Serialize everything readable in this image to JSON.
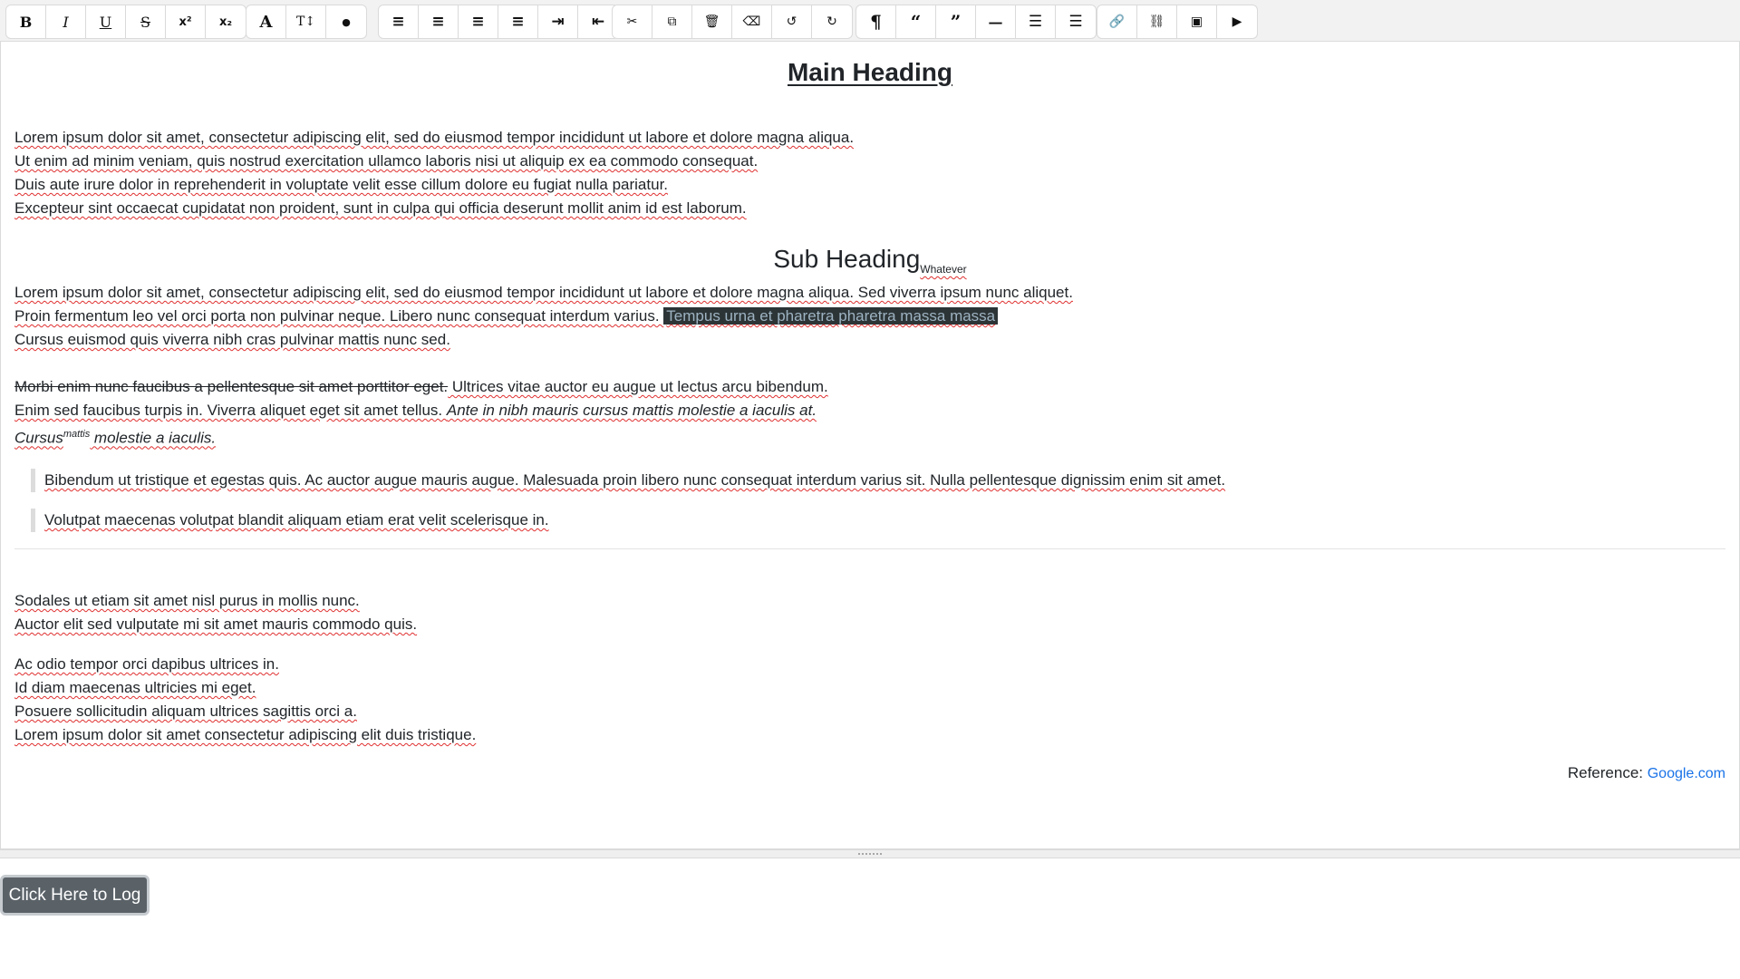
{
  "toolbar": {
    "groups": [
      [
        {
          "name": "bold-button",
          "icon": "bold-icon",
          "glyph": "B"
        },
        {
          "name": "italic-button",
          "icon": "italic-icon",
          "glyph": "I"
        },
        {
          "name": "underline-button",
          "icon": "underline-icon",
          "glyph": "U"
        },
        {
          "name": "strikethrough-button",
          "icon": "strikethrough-icon",
          "glyph": "S"
        },
        {
          "name": "superscript-button",
          "icon": "superscript-icon",
          "glyph": "x²"
        },
        {
          "name": "subscript-button",
          "icon": "subscript-icon",
          "glyph": "x₂"
        }
      ],
      [
        {
          "name": "font-button",
          "icon": "font-icon",
          "glyph": "A"
        },
        {
          "name": "font-size-button",
          "icon": "text-height-icon",
          "glyph": "T↕"
        },
        {
          "name": "color-button",
          "icon": "tint-icon",
          "glyph": "●"
        }
      ],
      [
        {
          "name": "align-left-button",
          "icon": "align-left-icon",
          "glyph": "≡"
        },
        {
          "name": "align-center-button",
          "icon": "align-center-icon",
          "glyph": "≡"
        },
        {
          "name": "align-right-button",
          "icon": "align-right-icon",
          "glyph": "≡"
        },
        {
          "name": "justify-button",
          "icon": "align-justify-icon",
          "glyph": "≡"
        },
        {
          "name": "indent-button",
          "icon": "indent-icon",
          "glyph": "⇥"
        },
        {
          "name": "outdent-button",
          "icon": "outdent-icon",
          "glyph": "⇤"
        }
      ],
      [
        {
          "name": "cut-button",
          "icon": "scissors-icon",
          "glyph": "✂"
        },
        {
          "name": "copy-button",
          "icon": "copy-icon",
          "glyph": "⧉"
        },
        {
          "name": "delete-button",
          "icon": "trash-icon",
          "glyph": "🗑"
        },
        {
          "name": "clear-format-button",
          "icon": "eraser-icon",
          "glyph": "⌫"
        },
        {
          "name": "undo-button",
          "icon": "undo-icon",
          "glyph": "↺"
        },
        {
          "name": "redo-button",
          "icon": "redo-icon",
          "glyph": "↻"
        }
      ],
      [
        {
          "name": "paragraph-button",
          "icon": "paragraph-icon",
          "glyph": "¶"
        },
        {
          "name": "quote-left-button",
          "icon": "quote-left-icon",
          "glyph": "“"
        },
        {
          "name": "quote-right-button",
          "icon": "quote-right-icon",
          "glyph": "”"
        },
        {
          "name": "horizontal-rule-button",
          "icon": "minus-icon",
          "glyph": "—"
        },
        {
          "name": "bullet-list-button",
          "icon": "list-ul-icon",
          "glyph": "☰"
        },
        {
          "name": "numbered-list-button",
          "icon": "list-ol-icon",
          "glyph": "☰"
        }
      ],
      [
        {
          "name": "link-button",
          "icon": "link-icon",
          "glyph": "🔗"
        },
        {
          "name": "unlink-button",
          "icon": "unlink-icon",
          "glyph": "⛓"
        },
        {
          "name": "image-button",
          "icon": "image-icon",
          "glyph": "▣"
        },
        {
          "name": "video-button",
          "icon": "youtube-icon",
          "glyph": "▶"
        }
      ]
    ]
  },
  "editor": {
    "main_heading": "Main Heading",
    "intro_lines": [
      "Lorem ipsum dolor sit amet, consectetur adipiscing elit, sed do eiusmod tempor incididunt ut labore et dolore magna aliqua.",
      "Ut enim ad minim veniam, quis nostrud exercitation ullamco laboris nisi ut aliquip ex ea commodo consequat.",
      "Duis aute irure dolor in reprehenderit in voluptate velit esse cillum dolore eu fugiat nulla pariatur.",
      "Excepteur sint occaecat cupidatat non proident, sunt in culpa qui officia deserunt mollit anim id est laborum."
    ],
    "sub_heading": "Sub Heading",
    "sub_heading_subscript": "Whatever",
    "section2": {
      "line1": "Lorem ipsum dolor sit amet, consectetur adipiscing elit, sed do eiusmod tempor incididunt ut labore et dolore magna aliqua. Sed viverra ipsum nunc aliquet.",
      "line2_plain": "Proin fermentum leo vel orci porta non pulvinar neque. Libero nunc consequat interdum varius. ",
      "line2_selected": "Tempus urna et pharetra pharetra massa massa",
      "line3": "Cursus euismod quis viverra nibh cras pulvinar mattis nunc sed."
    },
    "section3": {
      "strike_text": "Morbi enim nunc faucibus a pellentesque sit amet porttitor eget.",
      "line1_rest": " Ultrices vitae auctor eu augue ut lectus arcu bibendum.",
      "line2_plain": "Enim sed faucibus turpis in. Viverra aliquet eget sit amet tellus. ",
      "line2_italic": "Ante in nibh mauris cursus mattis molestie a iaculis at.",
      "line3_italic_a": "Cursus",
      "line3_sup": "mattis",
      "line3_italic_b": " molestie a iaculis."
    },
    "blockquotes": [
      "Bibendum ut tristique et egestas quis. Ac auctor augue mauris augue. Malesuada proin libero nunc consequat interdum varius sit. Nulla pellentesque dignissim enim sit amet.",
      " Volutpat maecenas volutpat blandit aliquam etiam erat velit scelerisque in."
    ],
    "after_rule_lines_a": [
      "Sodales ut etiam sit amet nisl purus in mollis nunc.",
      "Auctor elit sed vulputate mi sit amet mauris commodo quis."
    ],
    "after_rule_lines_b": [
      "Ac odio tempor orci dapibus ultrices in.",
      "Id diam maecenas ultricies mi eget.",
      "Posuere sollicitudin aliquam ultrices sagittis orci a.",
      "Lorem ipsum dolor sit amet consectetur adipiscing elit duis tristique."
    ],
    "reference_label": "Reference: ",
    "reference_link": "Google.com"
  },
  "log_button_label": "Click Here to Log",
  "colors": {
    "selection_bg": "#2c3436",
    "selection_text": "#9eb3c2",
    "link": "#1a73e8",
    "button_bg": "#5a6268"
  }
}
